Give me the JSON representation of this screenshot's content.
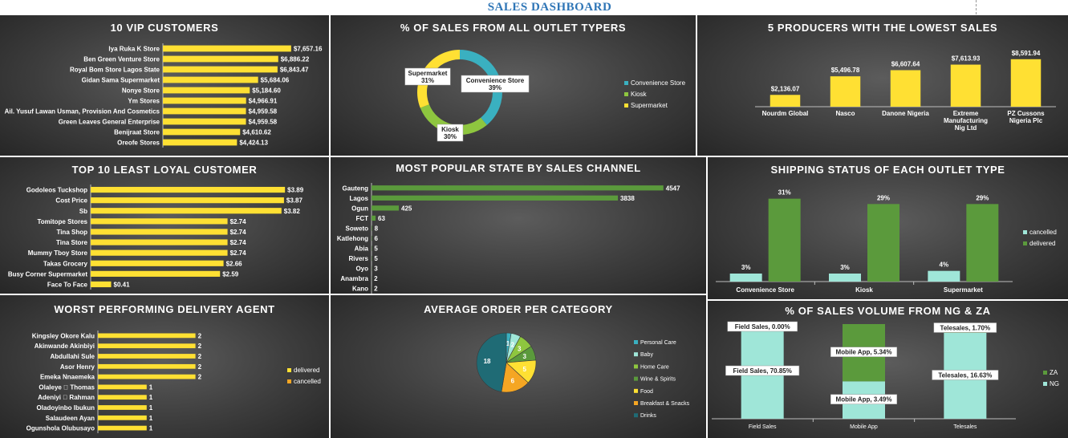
{
  "dashboard": {
    "title": "SALES DASHBOARD"
  },
  "colors": {
    "yellow": "#ffe033",
    "green": "#5b9a3c",
    "green_light": "#8ec63f",
    "teal": "#3ab0c0",
    "mint": "#9fe6d8"
  },
  "chart_data": [
    {
      "id": "vip",
      "type": "bar",
      "orientation": "horizontal",
      "title": "10 VIP CUSTOMERS",
      "categories": [
        "Iya Ruka K Store",
        "Ben Green Venture Store",
        "Royal Bom Store Lagos State",
        "Gidan Sama Supermarket",
        "Nonye Store",
        "Ym Stores",
        "Ail. Yusuf Lawan Usman, Provision And Cosmetics",
        "Green Leaves General Enterprise",
        "Benijraat  Store",
        "Oreofe Stores"
      ],
      "values": [
        7657.16,
        6886.22,
        6843.47,
        5684.06,
        5184.6,
        4966.91,
        4959.58,
        4959.58,
        4610.62,
        4424.13
      ],
      "labels": [
        "$7,657.16",
        "$6,886.22",
        "$6,843.47",
        "$5,684.06",
        "$5,184.60",
        "$4,966.91",
        "$4,959.58",
        "$4,959.58",
        "$4,610.62",
        "$4,424.13"
      ],
      "xlim": [
        0,
        8000
      ]
    },
    {
      "id": "outlet_share",
      "type": "pie",
      "donut": true,
      "title": "% OF SALES FROM ALL OUTLET TYPERS",
      "categories": [
        "Convenience Store",
        "Kiosk",
        "Supermarket"
      ],
      "values": [
        39,
        30,
        31
      ],
      "labels": [
        "39%",
        "30%",
        "31%"
      ],
      "colors": [
        "#3ab0c0",
        "#8ec63f",
        "#ffe033"
      ],
      "legend": "right"
    },
    {
      "id": "lowest_producers",
      "type": "bar",
      "title": "5 PRODUCERS WITH THE LOWEST SALES",
      "categories": [
        "Nourdm Global",
        "Nasco",
        "Danone Nigeria",
        "Extreme Manufacturing Nig Ltd",
        "PZ Cussons Nigeria Plc"
      ],
      "values": [
        2136.07,
        5496.78,
        6607.64,
        7613.93,
        8591.94
      ],
      "labels": [
        "$2,136.07",
        "$5,496.78",
        "$6,607.64",
        "$7,613.93",
        "$8,591.94"
      ],
      "ylim": [
        0,
        9000
      ]
    },
    {
      "id": "least_loyal",
      "type": "bar",
      "orientation": "horizontal",
      "title": "TOP 10 LEAST LOYAL CUSTOMER",
      "categories": [
        "Godoleos Tuckshop",
        "Cost Price",
        "Sb",
        "Tomitope Stores",
        "Tina Shop",
        "Tina Store",
        "Mummy Tboy Store",
        "Takas Grocery",
        "Busy Corner Supermarket",
        "Face To Face"
      ],
      "values": [
        3.89,
        3.87,
        3.82,
        2.74,
        2.74,
        2.74,
        2.74,
        2.66,
        2.59,
        0.41
      ],
      "labels": [
        "$3.89",
        "$3.87",
        "$3.82",
        "$2.74",
        "$2.74",
        "$2.74",
        "$2.74",
        "$2.66",
        "$2.59",
        "$0.41"
      ],
      "xlim": [
        0,
        4
      ]
    },
    {
      "id": "state_channel",
      "type": "bar",
      "orientation": "horizontal",
      "title": "MOST POPULAR STATE BY SALES CHANNEL",
      "categories": [
        "Gauteng",
        "Lagos",
        "Ogun",
        "FCT",
        "Soweto",
        "Katlehong",
        "Abia",
        "Rivers",
        "Oyo",
        "Anambra",
        "Kano"
      ],
      "values": [
        4547,
        3838,
        425,
        63,
        8,
        6,
        5,
        5,
        3,
        2,
        2
      ],
      "labels": [
        "4547",
        "3838",
        "425",
        "63",
        "8",
        "6",
        "5",
        "5",
        "3",
        "2",
        "2"
      ],
      "xlim": [
        0,
        4600
      ]
    },
    {
      "id": "shipping",
      "type": "bar",
      "title": "SHIPPING STATUS OF EACH OUTLET TYPE",
      "categories": [
        "Convenience Store",
        "Kiosk",
        "Supermarket"
      ],
      "series": [
        {
          "name": "cancelled",
          "values": [
            3,
            3,
            4
          ],
          "labels": [
            "3%",
            "3%",
            "4%"
          ],
          "color": "#9fe6d8"
        },
        {
          "name": "delivered",
          "values": [
            31,
            29,
            29
          ],
          "labels": [
            "31%",
            "29%",
            "29%"
          ],
          "color": "#5b9a3c"
        }
      ],
      "ylim": [
        0,
        33
      ],
      "legend": "right"
    },
    {
      "id": "agents",
      "type": "bar",
      "orientation": "horizontal",
      "title": "WORST PERFORMING DELIVERY AGENT",
      "categories": [
        "Kingsley Okore  Kalu",
        "Akinwande Akinbiyi",
        "Abdullahi Sule",
        "Asor Henry",
        "Emeka Nnaemeka",
        "Olaleye \u0000 Thomas",
        "Adeniyi \u0000 Rahman",
        "Oladoyinbo  Ibukun",
        "Salaudeen  Ayan",
        "Ogunshola Olubusayo"
      ],
      "series": [
        {
          "name": "delivered",
          "values": [
            2,
            2,
            2,
            2,
            2,
            1,
            1,
            1,
            1,
            1
          ],
          "labels": [
            "2",
            "2",
            "2",
            "2",
            "2",
            "1",
            "1",
            "1",
            "1",
            "1"
          ],
          "color": "#ffe033"
        },
        {
          "name": "cancelled",
          "values": [
            0,
            0,
            0,
            0,
            0,
            0,
            0,
            0,
            0,
            0
          ],
          "color": "#f5a623"
        }
      ],
      "xlim": [
        0,
        2.5
      ],
      "legend": "right"
    },
    {
      "id": "avg_order",
      "type": "pie",
      "title": "AVERAGE ORDER PER CATEGORY",
      "categories": [
        "Personal Care",
        "Baby",
        "Home Care",
        "Wine & Spirits",
        "Food",
        "Breakfast & Snacks",
        "Drinks"
      ],
      "values": [
        1,
        2,
        3,
        3,
        5,
        6,
        18
      ],
      "labels": [
        "1",
        "2",
        "3",
        "3",
        "5",
        "6",
        "18"
      ],
      "colors": [
        "#3ab0c0",
        "#9fe6d8",
        "#8ec63f",
        "#5b9a3c",
        "#ffe033",
        "#f5a623",
        "#1f6b75"
      ],
      "legend": "right"
    },
    {
      "id": "volume_ng_za",
      "type": "bar",
      "stacked": true,
      "title": "% OF SALES VOLUME FROM NG & ZA",
      "categories": [
        "Field Sales",
        "Mobile App",
        "Telesales"
      ],
      "series": [
        {
          "name": "NG",
          "values": [
            70.85,
            3.49,
            16.63
          ],
          "labels": [
            "Field Sales, 70.85%",
            "Mobile App, 3.49%",
            "Telesales, 16.63%"
          ],
          "color": "#9fe6d8"
        },
        {
          "name": "ZA",
          "values": [
            0.0,
            5.34,
            1.7
          ],
          "labels": [
            "Field Sales, 0.00%",
            "Mobile App, 5.34%",
            "Telesales, 1.70%"
          ],
          "color": "#5b9a3c"
        }
      ],
      "normalized": true,
      "legend": "right"
    }
  ]
}
